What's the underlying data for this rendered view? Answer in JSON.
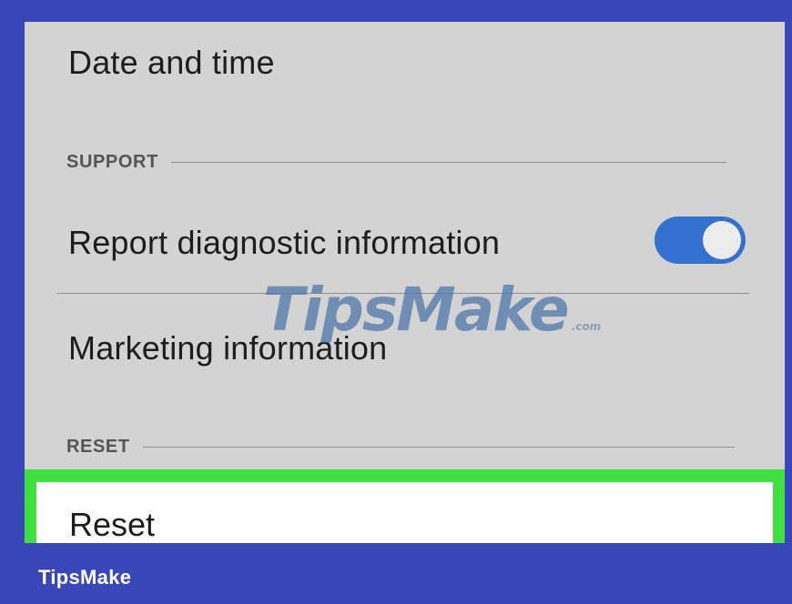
{
  "settings": {
    "date_and_time": "Date and time",
    "support_header": "SUPPORT",
    "report_diagnostic": "Report diagnostic information",
    "report_diagnostic_enabled": true,
    "marketing_information": "Marketing information",
    "reset_header": "RESET",
    "reset_label": "Reset"
  },
  "watermark": {
    "main": "TipsMake",
    "sub": ".com"
  },
  "footer": {
    "brand": "TipsMake"
  },
  "colors": {
    "background_frame": "#3a47b8",
    "screen_bg": "#d3d3d3",
    "toggle_on": "#3470d0",
    "highlight": "#41e041"
  }
}
